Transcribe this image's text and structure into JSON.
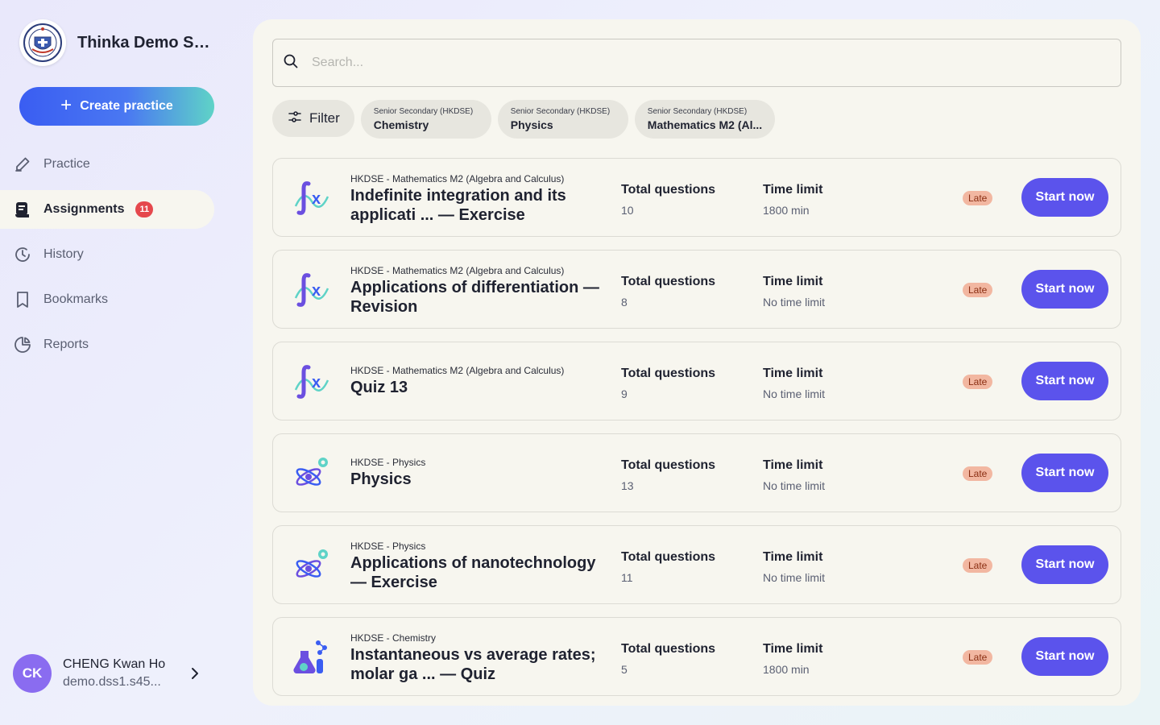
{
  "brand": {
    "name": "Thinka Demo Se..."
  },
  "sidebar": {
    "create_label": "Create practice",
    "items": [
      {
        "label": "Practice",
        "icon": "pencil-icon"
      },
      {
        "label": "Assignments",
        "icon": "assignment-icon",
        "badge": "11",
        "active": true
      },
      {
        "label": "History",
        "icon": "history-icon"
      },
      {
        "label": "Bookmarks",
        "icon": "bookmark-icon"
      },
      {
        "label": "Reports",
        "icon": "pie-chart-icon"
      }
    ]
  },
  "user": {
    "initials": "CK",
    "name": "CHENG Kwan Ho",
    "email": "demo.dss1.s45..."
  },
  "search": {
    "placeholder": "Search...",
    "value": ""
  },
  "filters": {
    "filter_label": "Filter",
    "chips": [
      {
        "category": "Senior Secondary (HKDSE)",
        "name": "Chemistry"
      },
      {
        "category": "Senior Secondary (HKDSE)",
        "name": "Physics"
      },
      {
        "category": "Senior Secondary (HKDSE)",
        "name": "Mathematics M2 (Al..."
      }
    ]
  },
  "labels": {
    "total_questions": "Total questions",
    "time_limit": "Time limit",
    "late": "Late",
    "start": "Start now"
  },
  "assignments": [
    {
      "subject": "HKDSE - Mathematics M2 (Algebra and Calculus)",
      "title": "Indefinite integration and its applicati ... — Exercise",
      "questions": "10",
      "time": "1800 min",
      "icon": "math-integral-icon"
    },
    {
      "subject": "HKDSE - Mathematics M2 (Algebra and Calculus)",
      "title": "Applications of differentiation — Revision",
      "questions": "8",
      "time": "No time limit",
      "icon": "math-integral-icon"
    },
    {
      "subject": "HKDSE - Mathematics M2 (Algebra and Calculus)",
      "title": "Quiz 13",
      "questions": "9",
      "time": "No time limit",
      "icon": "math-integral-icon"
    },
    {
      "subject": "HKDSE - Physics",
      "title": "Physics",
      "questions": "13",
      "time": "No time limit",
      "icon": "physics-atom-icon"
    },
    {
      "subject": "HKDSE - Physics",
      "title": "Applications of nanotechnology — Exercise",
      "questions": "11",
      "time": "No time limit",
      "icon": "physics-atom-icon"
    },
    {
      "subject": "HKDSE - Chemistry",
      "title": "Instantaneous vs average rates; molar ga ... — Quiz",
      "questions": "5",
      "time": "1800 min",
      "icon": "chemistry-flask-icon"
    }
  ],
  "colors": {
    "accent": "#5b53ec",
    "late_bg": "#f2b7a1",
    "badge": "#e5484d",
    "panel": "#f7f6ef"
  }
}
